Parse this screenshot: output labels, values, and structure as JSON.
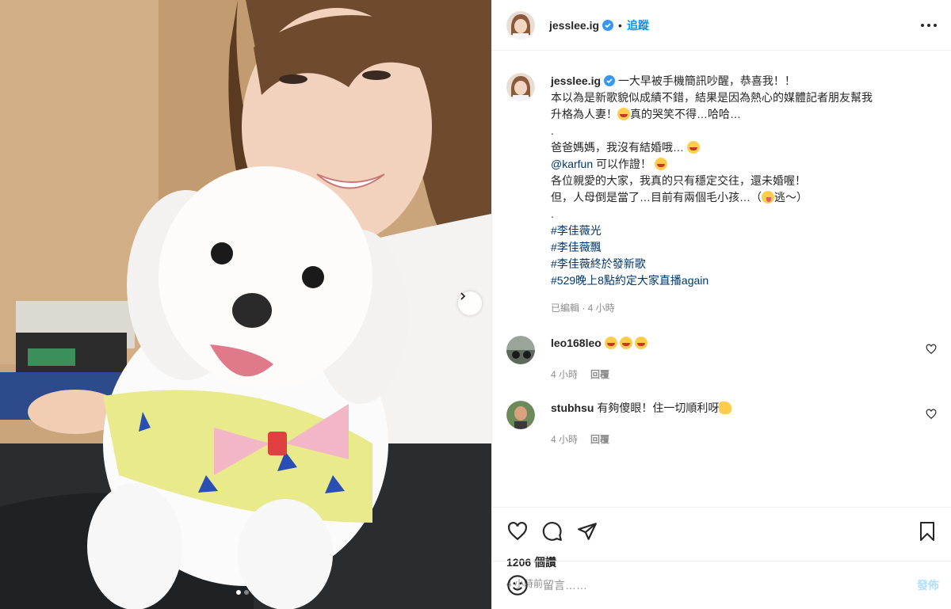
{
  "account": {
    "username": "jesslee.ig",
    "separator": "•",
    "follow_label": "追蹤"
  },
  "caption": {
    "username": "jesslee.ig",
    "line1": "一大早被手機簡訊吵醒，恭喜我！！",
    "line2": "本以為是新歌貌似成績不錯，結果是因為熱心的媒體記者朋友幫我",
    "line3_a": "升格為人妻！",
    "line3_b": "真的哭笑不得…哈哈…",
    "line4": ".",
    "line5": "爸爸媽媽，我沒有結婚哦…",
    "mention": "@karfun",
    "line6": " 可以作證！",
    "line7": "各位親愛的大家，我真的只有穩定交往，還未婚喔！",
    "line8_a": "但，人母倒是當了…目前有兩個毛小孩…（",
    "line8_b": "逃～）",
    "line9": ".",
    "hashtags": [
      "#李佳薇光",
      "#李佳薇飄",
      "#李佳薇終於發新歌",
      "#529晚上8點約定大家直播again"
    ],
    "meta": "已編輯 · 4 小時"
  },
  "comments": [
    {
      "username": "leo168leo",
      "text": "",
      "time": "4 小時",
      "reply_label": "回覆"
    },
    {
      "username": "stubhsu",
      "text": "有夠傻眼！住一切順利呀",
      "time": "4 小時",
      "reply_label": "回覆"
    }
  ],
  "stats": {
    "likes": "1206 個讚",
    "posted": "4 小時前"
  },
  "composer": {
    "placeholder": "留言……",
    "post_label": "發佈"
  },
  "carousel": {
    "current": 1,
    "total": 2
  },
  "colors": {
    "link": "#00376b",
    "accent": "#0095f6",
    "muted": "#8e8e8e",
    "verified": "#3897f0"
  }
}
